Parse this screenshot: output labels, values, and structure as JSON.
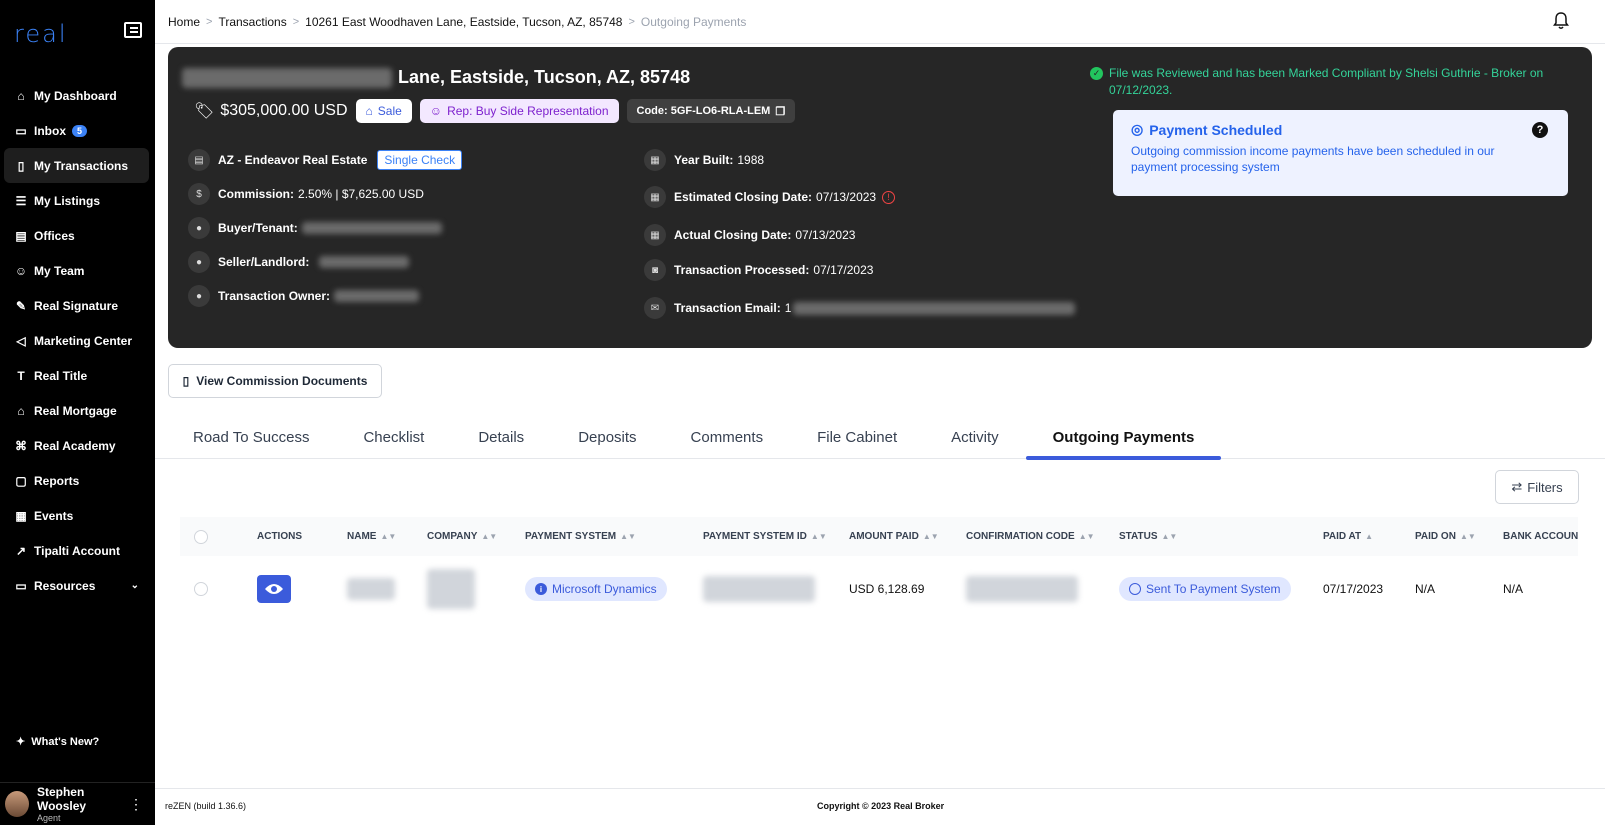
{
  "sidebar": {
    "logo": "real",
    "items": [
      {
        "label": "My Dashboard",
        "icon": "home-icon"
      },
      {
        "label": "Inbox",
        "icon": "inbox-icon",
        "badge": "5"
      },
      {
        "label": "My Transactions",
        "icon": "transactions-icon",
        "active": true
      },
      {
        "label": "My Listings",
        "icon": "list-icon"
      },
      {
        "label": "Offices",
        "icon": "building-icon"
      },
      {
        "label": "My Team",
        "icon": "team-icon"
      },
      {
        "label": "Real Signature",
        "icon": "signature-icon"
      },
      {
        "label": "Marketing Center",
        "icon": "megaphone-icon"
      },
      {
        "label": "Real Title",
        "icon": "title-icon"
      },
      {
        "label": "Real Mortgage",
        "icon": "bank-icon"
      },
      {
        "label": "Real Academy",
        "icon": "academy-icon"
      },
      {
        "label": "Reports",
        "icon": "report-icon"
      },
      {
        "label": "Events",
        "icon": "calendar-icon"
      },
      {
        "label": "Tipalti Account",
        "icon": "external-link-icon"
      },
      {
        "label": "Resources",
        "icon": "folder-icon"
      }
    ],
    "whats_new": "What's New?",
    "user": {
      "name": "Stephen Woosley",
      "role": "Agent"
    }
  },
  "breadcrumb": {
    "items": [
      "Home",
      "Transactions",
      "10261 East Woodhaven Lane, Eastside, Tucson, AZ, 85748"
    ],
    "current": "Outgoing Payments"
  },
  "hero": {
    "address_visible": "Lane, Eastside, Tucson, AZ, 85748",
    "price": "$305,000.00 USD",
    "sale_label": "Sale",
    "rep_label": "Rep: Buy Side Representation",
    "code_label": "Code: 5GF-LO6-RLA-LEM",
    "office": "AZ - Endeavor Real Estate",
    "single_check": "Single Check",
    "commission_label": "Commission:",
    "commission_value": "2.50% | $7,625.00 USD",
    "buyer_label": "Buyer/Tenant:",
    "seller_label": "Seller/Landlord:",
    "owner_label": "Transaction Owner:",
    "year_built_label": "Year Built:",
    "year_built": "1988",
    "est_closing_label": "Estimated Closing Date:",
    "est_closing": "07/13/2023",
    "actual_closing_label": "Actual Closing Date:",
    "actual_closing": "07/13/2023",
    "processed_label": "Transaction Processed:",
    "processed": "07/17/2023",
    "email_label": "Transaction Email:",
    "email_prefix": "1",
    "compliance_text": "File was Reviewed and has been Marked Compliant by Shelsi Guthrie - Broker on 07/12/2023.",
    "scheduled_title": "Payment Scheduled",
    "scheduled_desc": "Outgoing commission income payments have been scheduled in our payment processing system",
    "help": "?"
  },
  "docs_button": "View Commission Documents",
  "tabs": [
    "Road To Success",
    "Checklist",
    "Details",
    "Deposits",
    "Comments",
    "File Cabinet",
    "Activity",
    "Outgoing Payments"
  ],
  "active_tab": "Outgoing Payments",
  "filters_label": "Filters",
  "table": {
    "headers": [
      "ACTIONS",
      "NAME",
      "COMPANY",
      "PAYMENT SYSTEM",
      "PAYMENT SYSTEM ID",
      "AMOUNT PAID",
      "CONFIRMATION CODE",
      "STATUS",
      "PAID AT",
      "PAID ON",
      "BANK ACCOUNT"
    ],
    "row": {
      "payment_system": "Microsoft Dynamics",
      "amount_paid": "USD 6,128.69",
      "status": "Sent To Payment System",
      "paid_at": "07/17/2023",
      "paid_on": "N/A",
      "bank_account": "N/A"
    }
  },
  "footer": {
    "build": "reZEN (build 1.36.6)",
    "copyright": "Copyright © 2023 Real Broker"
  },
  "colors": {
    "accent": "#3b5bdb",
    "compliant": "#34d399",
    "hero_bg": "#262626"
  }
}
